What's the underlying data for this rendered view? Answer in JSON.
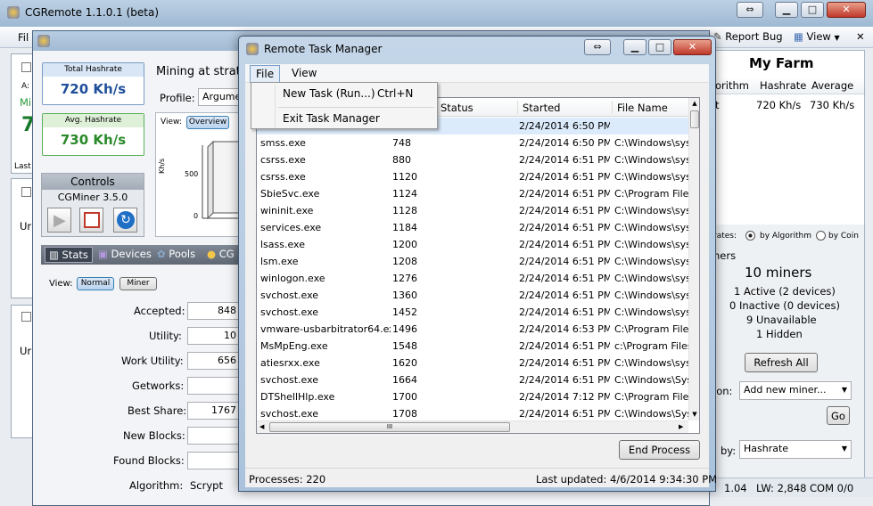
{
  "main_window": {
    "title": "CGRemote 1.1.0.1 (beta)",
    "menu_file_partial": "Fil",
    "report_bug": "Report Bug",
    "view": "View",
    "my_farm_title": "My Farm",
    "farm_columns": [
      "orithm",
      "Hashrate",
      "Average"
    ],
    "farm_row": {
      "name": "t",
      "hashrate": "720 Kh/s",
      "average": "730 Kh/s"
    },
    "rates_label": "rates:",
    "by_algorithm": "by Algorithm",
    "by_coin": "by Coin",
    "miners_header": "ners",
    "miners_total": "10 miners",
    "miners_active": "1 Active  (2 devices)",
    "miners_inactive": "0 Inactive  (0 devices)",
    "miners_unavailable": "9 Unavailable",
    "miners_hidden": "1 Hidden",
    "refresh_all": "Refresh All",
    "action_label": "ion:",
    "add_new_miner": "Add new miner...",
    "go": "Go",
    "sort_label": "by:",
    "sort_value": "Hashrate",
    "status_bar": {
      "a": "1.04",
      "lw": "LW: 2,848",
      "com": "COM 0/0"
    },
    "left_snippets": {
      "a_label": "A:",
      "mi": "Mi",
      "seven": "7",
      "last": "Last",
      "un1": "Ur",
      "un2": "Ur"
    }
  },
  "miner_window": {
    "total_hashrate_label": "Total Hashrate",
    "total_hashrate": "720 Kh/s",
    "avg_hashrate_label": "Avg. Hashrate",
    "avg_hashrate": "730 Kh/s",
    "mining_at": "Mining at stratu",
    "profile_label": "Profile:",
    "profile_value": "Argume",
    "view_label": "View:",
    "overview_tab": "Overview",
    "chart_ylabel": "Kh/s",
    "chart_tick_500": "500",
    "chart_tick_0": "0",
    "controls_title": "Controls",
    "cgminer_version": "CGMiner 3.5.0",
    "tabs": [
      "Stats",
      "Devices",
      "Pools",
      "CG"
    ],
    "view2_label": "View:",
    "normal_btn": "Normal",
    "miner_btn": "Miner",
    "stats": [
      {
        "label": "Accepted:",
        "value": "848"
      },
      {
        "label": "Utility:",
        "value": "10"
      },
      {
        "label": "Work Utility:",
        "value": "656"
      },
      {
        "label": "Getworks:",
        "value": ""
      },
      {
        "label": "Best Share:",
        "value": "1767"
      },
      {
        "label": "New Blocks:",
        "value": ""
      },
      {
        "label": "Found Blocks:",
        "value": ""
      },
      {
        "label": "Algorithm:",
        "value": "Scrypt"
      }
    ]
  },
  "task_manager": {
    "title": "Remote Task Manager",
    "menu": [
      "File",
      "View"
    ],
    "file_menu_items": [
      {
        "label": "New Task (Run...)",
        "shortcut": "Ctrl+N"
      },
      {
        "label": "Exit Task Manager",
        "shortcut": ""
      }
    ],
    "columns": [
      "Status",
      "Started",
      "File Name"
    ],
    "rows": [
      {
        "name": "",
        "pid": "",
        "started": "2/24/2014 6:50 PM",
        "file": ""
      },
      {
        "name": "smss.exe",
        "pid": "748",
        "started": "2/24/2014 6:50 PM",
        "file": "C:\\Windows\\sys"
      },
      {
        "name": "csrss.exe",
        "pid": "880",
        "started": "2/24/2014 6:51 PM",
        "file": "C:\\Windows\\sys"
      },
      {
        "name": "csrss.exe",
        "pid": "1120",
        "started": "2/24/2014 6:51 PM",
        "file": "C:\\Windows\\sys"
      },
      {
        "name": "SbieSvc.exe",
        "pid": "1124",
        "started": "2/24/2014 6:51 PM",
        "file": "C:\\Program Files"
      },
      {
        "name": "wininit.exe",
        "pid": "1128",
        "started": "2/24/2014 6:51 PM",
        "file": "C:\\Windows\\sys"
      },
      {
        "name": "services.exe",
        "pid": "1184",
        "started": "2/24/2014 6:51 PM",
        "file": "C:\\Windows\\sys"
      },
      {
        "name": "lsass.exe",
        "pid": "1200",
        "started": "2/24/2014 6:51 PM",
        "file": "C:\\Windows\\sys"
      },
      {
        "name": "lsm.exe",
        "pid": "1208",
        "started": "2/24/2014 6:51 PM",
        "file": "C:\\Windows\\sys"
      },
      {
        "name": "winlogon.exe",
        "pid": "1276",
        "started": "2/24/2014 6:51 PM",
        "file": "C:\\Windows\\sys"
      },
      {
        "name": "svchost.exe",
        "pid": "1360",
        "started": "2/24/2014 6:51 PM",
        "file": "C:\\Windows\\sys"
      },
      {
        "name": "svchost.exe",
        "pid": "1452",
        "started": "2/24/2014 6:51 PM",
        "file": "C:\\Windows\\sys"
      },
      {
        "name": "vmware-usbarbitrator64.exe",
        "pid": "1496",
        "started": "2/24/2014 6:53 PM",
        "file": "C:\\Program Files"
      },
      {
        "name": "MsMpEng.exe",
        "pid": "1548",
        "started": "2/24/2014 6:51 PM",
        "file": "c:\\Program Files"
      },
      {
        "name": "atiesrxx.exe",
        "pid": "1620",
        "started": "2/24/2014 6:51 PM",
        "file": "C:\\Windows\\sys"
      },
      {
        "name": "svchost.exe",
        "pid": "1664",
        "started": "2/24/2014 6:51 PM",
        "file": "C:\\Windows\\Sys"
      },
      {
        "name": "DTShellHlp.exe",
        "pid": "1700",
        "started": "2/24/2014 7:12 PM",
        "file": "C:\\Program Files"
      },
      {
        "name": "svchost.exe",
        "pid": "1708",
        "started": "2/24/2014 6:51 PM",
        "file": "C:\\Windows\\Sys"
      }
    ],
    "end_process": "End Process",
    "processes": "Processes: 220",
    "last_updated": "Last updated: 4/6/2014 9:34:30 PM",
    "scroll_grip": "III"
  }
}
